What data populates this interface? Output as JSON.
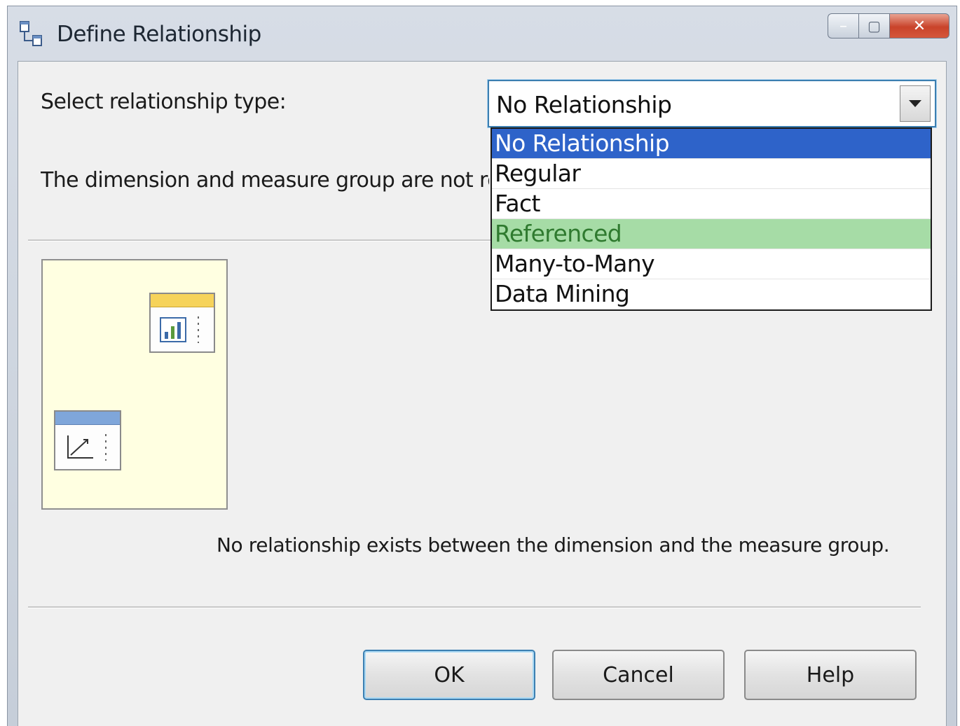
{
  "window": {
    "title": "Define Relationship",
    "controls": {
      "minimize": "–",
      "maximize": "▢",
      "close": "✕"
    }
  },
  "relationship": {
    "label": "Select relationship type:",
    "selected": "No Relationship",
    "options": [
      "No Relationship",
      "Regular",
      "Fact",
      "Referenced",
      "Many-to-Many",
      "Data Mining"
    ],
    "highlighted_option": "Referenced"
  },
  "description": "The dimension and measure group are not rel",
  "info_text": "No relationship exists between the dimension and the measure group.",
  "buttons": {
    "ok": "OK",
    "cancel": "Cancel",
    "help": "Help"
  },
  "colors": {
    "selection": "#2e63c9",
    "hover_highlight": "#a6dca6",
    "preview_background": "#ffffe1",
    "measure_header": "#f6d35a",
    "dimension_header": "#7fa6da"
  }
}
